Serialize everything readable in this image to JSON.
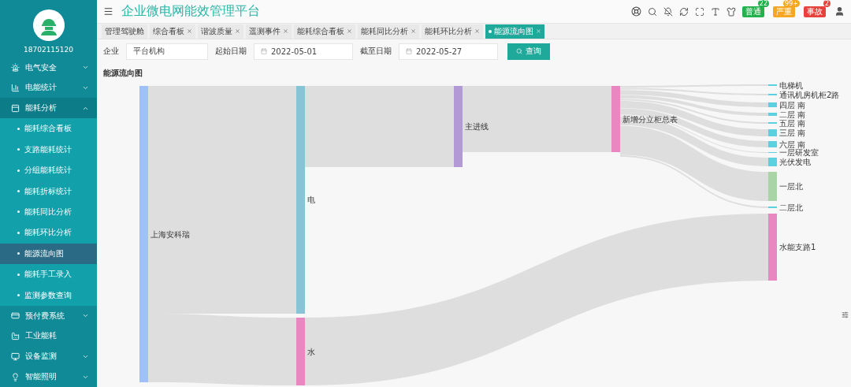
{
  "sidebar": {
    "user": "18702115120",
    "items": [
      {
        "label": "电气安全",
        "expanded": false
      },
      {
        "label": "电能统计",
        "expanded": false
      },
      {
        "label": "能耗分析",
        "expanded": true,
        "children": [
          {
            "label": "能耗综合看板",
            "selected": false
          },
          {
            "label": "支路能耗统计",
            "selected": false
          },
          {
            "label": "分组能耗统计",
            "selected": false
          },
          {
            "label": "能耗折标统计",
            "selected": false
          },
          {
            "label": "能耗同比分析",
            "selected": false
          },
          {
            "label": "能耗环比分析",
            "selected": false
          },
          {
            "label": "能源流向图",
            "selected": true
          },
          {
            "label": "能耗手工录入",
            "selected": false
          },
          {
            "label": "监测参数查询",
            "selected": false
          }
        ]
      },
      {
        "label": "预付费系统",
        "expanded": false
      },
      {
        "label": "工业能耗"
      },
      {
        "label": "设备监测",
        "expanded": false
      },
      {
        "label": "智能照明",
        "expanded": false
      }
    ]
  },
  "header": {
    "title": "企业微电网能效管理平台",
    "alerts": [
      {
        "label": "普通",
        "count": "22",
        "color": "#22b14c"
      },
      {
        "label": "严重",
        "count": "99+",
        "color": "#f5a623"
      },
      {
        "label": "事故",
        "count": "2",
        "color": "#e8413c"
      }
    ]
  },
  "tabs": [
    {
      "label": "管理驾驶舱",
      "closable": false,
      "selected": false
    },
    {
      "label": "综合看板",
      "closable": true,
      "selected": false
    },
    {
      "label": "谐波质量",
      "closable": true,
      "selected": false
    },
    {
      "label": "遥测事件",
      "closable": true,
      "selected": false
    },
    {
      "label": "能耗综合看板",
      "closable": true,
      "selected": false
    },
    {
      "label": "能耗同比分析",
      "closable": true,
      "selected": false
    },
    {
      "label": "能耗环比分析",
      "closable": true,
      "selected": false
    },
    {
      "label": "能源流向图",
      "closable": true,
      "selected": true
    }
  ],
  "filters": {
    "company_label": "企业",
    "company": "平台机构",
    "start_label": "起始日期",
    "start": "2022-05-01",
    "end_label": "截至日期",
    "end": "2022-05-27",
    "button": "查询"
  },
  "chart": {
    "title": "能源流向图",
    "nodes": [
      {
        "label": "上海安科瑞",
        "color": "#9fc0f8"
      },
      {
        "label": "电",
        "color": "#86c4d6"
      },
      {
        "label": "水",
        "color": "#e988c0"
      },
      {
        "label": "主进线",
        "color": "#b39ad6"
      },
      {
        "label": "新增分立柜总表",
        "color": "#e988c0"
      },
      {
        "label": "电梯机",
        "color": "#5bd0de"
      },
      {
        "label": "通讯机房机柜2路",
        "color": "#5bd0de"
      },
      {
        "label": "四层 南",
        "color": "#5bd0de"
      },
      {
        "label": "二层 南",
        "color": "#5bd0de"
      },
      {
        "label": "五层 南",
        "color": "#5bd0de"
      },
      {
        "label": "三层 南",
        "color": "#5bd0de"
      },
      {
        "label": "六层 南",
        "color": "#5bd0de"
      },
      {
        "label": "一层研发室",
        "color": "#5bd0de"
      },
      {
        "label": "光伏发电",
        "color": "#5bd0de"
      },
      {
        "label": "一层北",
        "color": "#a8d4a8"
      },
      {
        "label": "二层北",
        "color": "#5bd0de"
      },
      {
        "label": "水能支路1",
        "color": "#e988c0"
      }
    ]
  }
}
